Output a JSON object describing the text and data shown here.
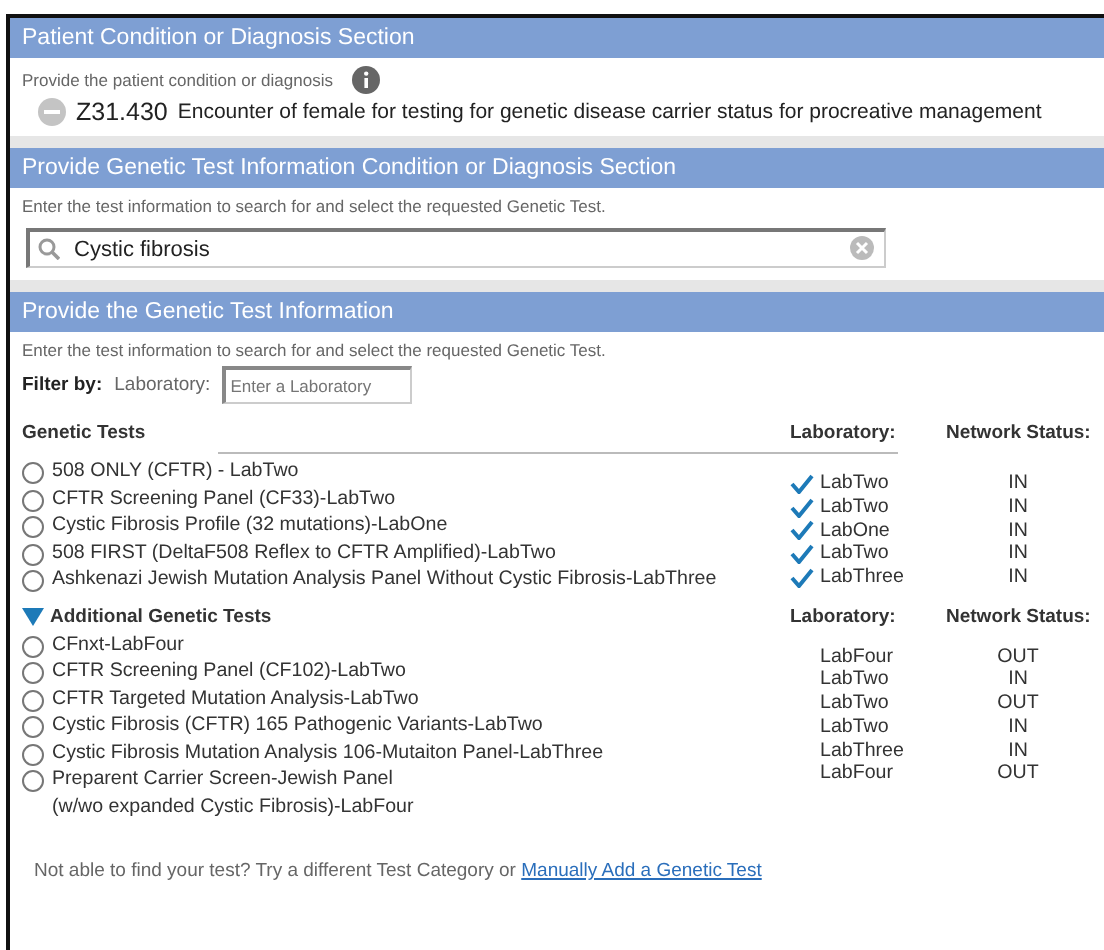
{
  "sections": [
    {
      "title": "Patient Condition or Diagnosis Section"
    },
    {
      "title": "Provide Genetic Test Information Condition or Diagnosis Section"
    },
    {
      "title": "Provide the Genetic Test Information"
    }
  ],
  "diagnosis": {
    "hint": "Provide the patient condition or diagnosis",
    "code": "Z31.430",
    "description": "Encounter of female for testing for genetic disease carrier status for procreative management"
  },
  "search": {
    "hint": "Enter the test information to search for and select the requested Genetic Test.",
    "value": "Cystic fibrosis"
  },
  "test_info": {
    "hint": "Enter the test information to search for and select the requested Genetic Test.",
    "filter_label": "Filter by:",
    "laboratory_label": "Laboratory:",
    "laboratory_placeholder": "Enter a Laboratory"
  },
  "groups": [
    {
      "title": "Genetic Tests",
      "kind": "plain",
      "lab_header": "Laboratory:",
      "status_header": "Network Status:",
      "tests": [
        {
          "name": "508 ONLY (CFTR) - LabTwo",
          "selected": false,
          "laboratory": "LabTwo",
          "verified": true,
          "status": "IN"
        },
        {
          "name": "CFTR Screening Panel (CF33)-LabTwo",
          "selected": false,
          "laboratory": "LabTwo",
          "verified": true,
          "status": "IN"
        },
        {
          "name": "Cystic Fibrosis Profile (32 mutations)-LabOne",
          "selected": false,
          "laboratory": "LabOne",
          "verified": true,
          "status": "IN"
        },
        {
          "name": "508 FIRST (DeltaF508 Reflex to CFTR Amplified)-LabTwo",
          "selected": false,
          "laboratory": "LabTwo",
          "verified": true,
          "status": "IN"
        },
        {
          "name": "Ashkenazi Jewish Mutation Analysis Panel Without Cystic Fibrosis-LabThree",
          "selected": false,
          "laboratory": "LabThree",
          "verified": true,
          "status": "IN"
        }
      ]
    },
    {
      "title": "Additional Genetic Tests",
      "kind": "collapsible",
      "expanded": true,
      "lab_header": "Laboratory:",
      "status_header": "Network Status:",
      "tests": [
        {
          "name": "CFnxt-LabFour",
          "selected": false,
          "laboratory": "LabFour",
          "verified": false,
          "status": "OUT"
        },
        {
          "name": "CFTR Screening Panel (CF102)-LabTwo",
          "selected": false,
          "laboratory": "LabTwo",
          "verified": false,
          "status": "IN"
        },
        {
          "name": "CFTR Targeted Mutation Analysis-LabTwo",
          "selected": false,
          "laboratory": "LabTwo",
          "verified": false,
          "status": "OUT"
        },
        {
          "name": "Cystic Fibrosis (CFTR) 165 Pathogenic Variants-LabTwo",
          "selected": false,
          "laboratory": "LabTwo",
          "verified": false,
          "status": "IN"
        },
        {
          "name": "Cystic Fibrosis Mutation Analysis 106-Mutaiton Panel-LabThree",
          "selected": false,
          "laboratory": "LabThree",
          "verified": false,
          "status": "IN"
        },
        {
          "name": "Preparent Carrier Screen-Jewish Panel\n(w/wo expanded Cystic Fibrosis)-LabFour",
          "selected": false,
          "laboratory": "LabFour",
          "verified": false,
          "status": "OUT"
        }
      ]
    }
  ],
  "footer": {
    "text": "Not able to find your test?  Try a different Test Category or",
    "link": "Manually Add a Genetic Test"
  }
}
